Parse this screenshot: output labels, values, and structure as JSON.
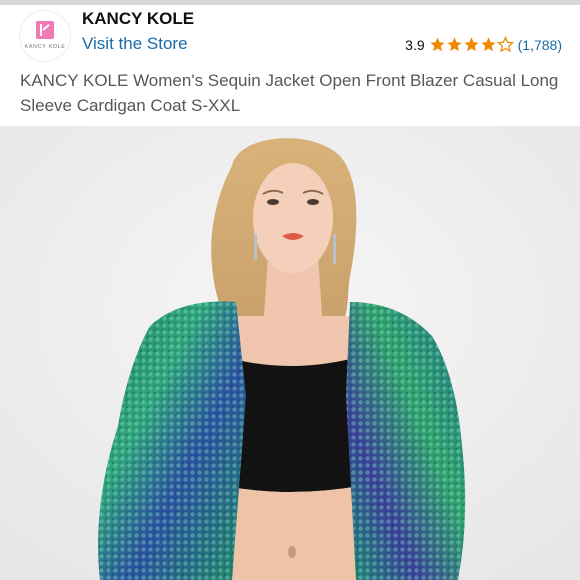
{
  "store": {
    "brand_name": "KANCY KOLE",
    "logo_text": "KANCY KOLE",
    "visit_label": "Visit the Store"
  },
  "rating": {
    "score": "3.9",
    "stars_value": 3.9,
    "stars_max": 5,
    "count": "(1,788)"
  },
  "product": {
    "title": "KANCY KOLE Women's Sequin Jacket Open Front Blazer Casual Long Sleeve Cardigan Coat S-XXL"
  },
  "colors": {
    "star": "#f08804",
    "link": "#1a6ca8",
    "logo_pink": "#f07ab8"
  },
  "icons": {
    "star_full": "star-icon",
    "star_empty": "star-outline-icon"
  }
}
